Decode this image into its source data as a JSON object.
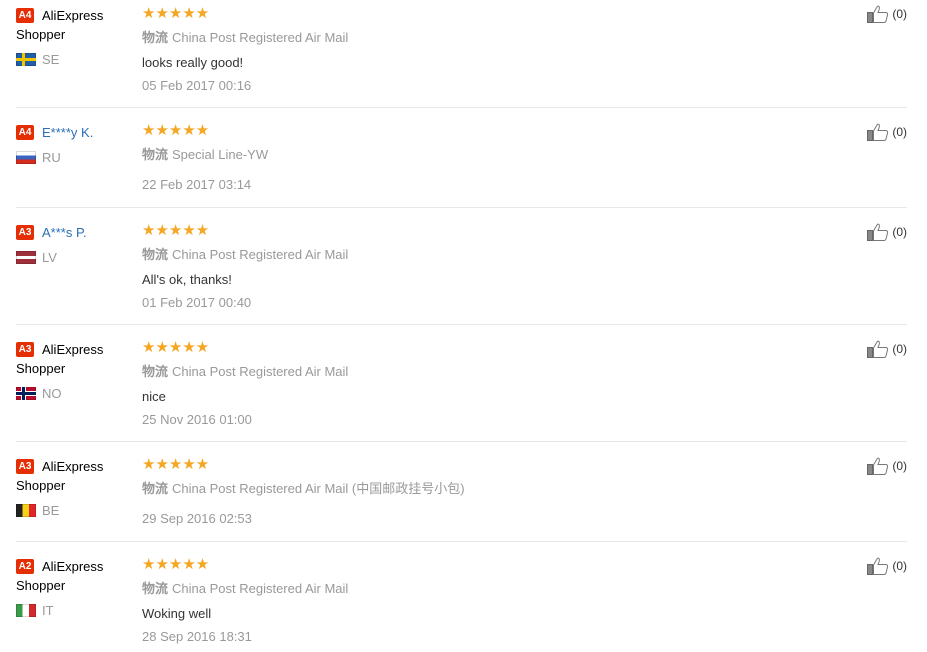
{
  "reviews": [
    {
      "badge": "A4",
      "name": "AliExpress Shopper",
      "country": "SE",
      "logistics_label": "物流",
      "logistics": "China Post Registered Air Mail",
      "comment": "looks really good!",
      "date": "05 Feb 2017 00:16",
      "stars": "★★★★★",
      "likes": "(0)"
    },
    {
      "badge": "A4",
      "name": "E****y K.",
      "country": "RU",
      "logistics_label": "物流",
      "logistics": "Special Line-YW",
      "comment": "",
      "date": "22 Feb 2017 03:14",
      "stars": "★★★★★",
      "likes": "(0)"
    },
    {
      "badge": "A3",
      "name": "A***s P.",
      "country": "LV",
      "logistics_label": "物流",
      "logistics": "China Post Registered Air Mail",
      "comment": "All's ok, thanks!",
      "date": "01 Feb 2017 00:40",
      "stars": "★★★★★",
      "likes": "(0)"
    },
    {
      "badge": "A3",
      "name": "AliExpress Shopper",
      "country": "NO",
      "logistics_label": "物流",
      "logistics": "China Post Registered Air Mail",
      "comment": "nice",
      "date": "25 Nov 2016 01:00",
      "stars": "★★★★★",
      "likes": "(0)"
    },
    {
      "badge": "A3",
      "name": "AliExpress Shopper",
      "country": "BE",
      "logistics_label": "物流",
      "logistics": "China Post Registered Air Mail (中国邮政挂号小包)",
      "comment": "",
      "date": "29 Sep 2016 02:53",
      "stars": "★★★★★",
      "likes": "(0)"
    },
    {
      "badge": "A2",
      "name": "AliExpress Shopper",
      "country": "IT",
      "logistics_label": "物流",
      "logistics": "China Post Registered Air Mail",
      "comment": "Woking well",
      "date": "28 Sep 2016 18:31",
      "stars": "★★★★★",
      "likes": "(0)"
    }
  ],
  "colors": {
    "badge": "#e62e04",
    "star": "#f5a623",
    "link": "#2a6fb5"
  }
}
